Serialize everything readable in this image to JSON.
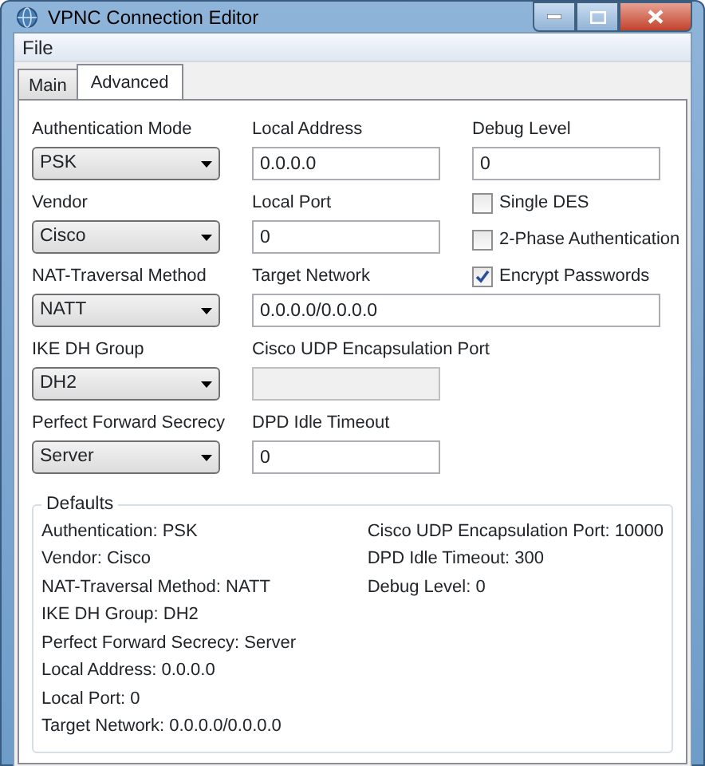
{
  "window": {
    "title": "VPNC Connection Editor"
  },
  "menu": [
    {
      "label": "File"
    }
  ],
  "tabs": [
    {
      "label": "Main",
      "selected": false
    },
    {
      "label": "Advanced",
      "selected": true
    }
  ],
  "fields": [
    {
      "kind": "dropdown",
      "label": "Authentication Mode",
      "value": "PSK"
    },
    {
      "kind": "text",
      "label": "Local Address",
      "value": "0.0.0.0"
    },
    {
      "kind": "text",
      "label": "Debug Level",
      "value": "0"
    },
    {
      "kind": "dropdown",
      "label": "Vendor",
      "value": "Cisco"
    },
    {
      "kind": "text",
      "label": "Local Port",
      "value": "0"
    },
    {
      "kind": "checkbox",
      "label": "Single DES",
      "checked": false
    },
    {
      "kind": "checkbox",
      "label": "2-Phase Authentication",
      "checked": false
    },
    {
      "kind": "dropdown",
      "label": "NAT-Traversal Method",
      "value": "NATT"
    },
    {
      "kind": "text",
      "label": "Target Network",
      "value": "0.0.0.0/0.0.0.0"
    },
    {
      "kind": "checkbox",
      "label": "Encrypt Passwords",
      "checked": true
    },
    {
      "kind": "dropdown",
      "label": "IKE DH Group",
      "value": "DH2"
    },
    {
      "kind": "text",
      "label": "Cisco UDP Encapsulation Port",
      "disabled": true
    },
    {
      "kind": "dropdown",
      "label": "Perfect Forward Secrecy",
      "value": "Server"
    },
    {
      "kind": "text",
      "label": "DPD Idle Timeout",
      "value": "0"
    }
  ],
  "defaults": {
    "title": "Defaults",
    "left": [
      "Authentication: PSK",
      "Vendor: Cisco",
      "NAT-Traversal Method: NATT",
      "IKE DH Group: DH2",
      "Perfect Forward Secrecy: Server",
      "Local Address: 0.0.0.0",
      "Local Port: 0",
      "Target Network: 0.0.0.0/0.0.0.0"
    ],
    "right": [
      "Cisco UDP Encapsulation Port: 10000",
      "DPD Idle Timeout: 300",
      "Debug Level: 0"
    ]
  }
}
